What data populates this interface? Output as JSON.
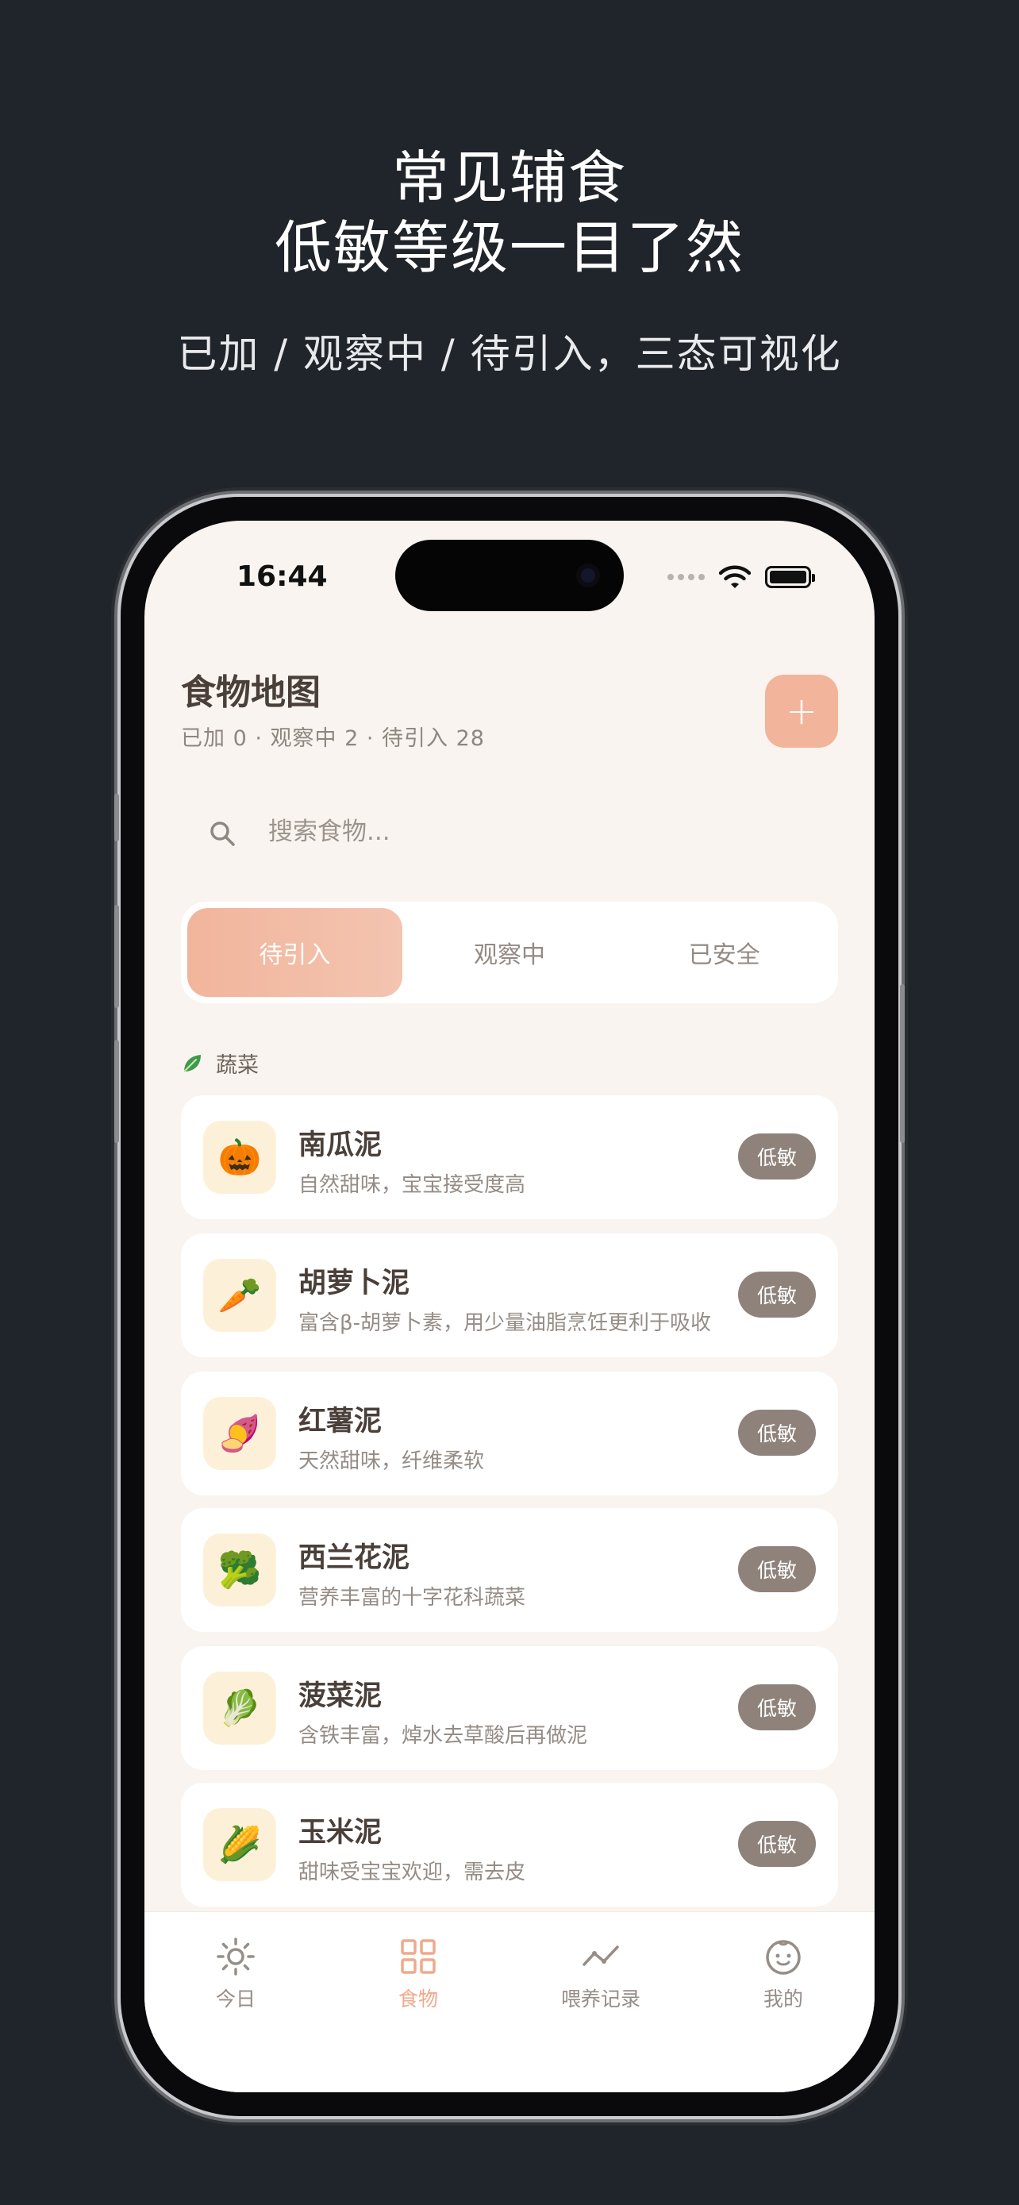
{
  "promo": {
    "title_line1": "常见辅食",
    "title_line2": "低敏等级一目了然",
    "subtitle": "已加 / 观察中 / 待引入，三态可视化"
  },
  "status_bar": {
    "time": "16:44"
  },
  "header": {
    "title": "食物地图",
    "summary": "已加 0 · 观察中 2 · 待引入 28",
    "add_label": "+"
  },
  "search": {
    "placeholder": "搜索食物..."
  },
  "segments": {
    "active": "待引入",
    "items": [
      "待引入",
      "观察中",
      "已安全"
    ]
  },
  "section": {
    "label": "蔬菜"
  },
  "foods": [
    {
      "emoji": "🎃",
      "name": "南瓜泥",
      "desc": "自然甜味，宝宝接受度高",
      "badge": "低敏"
    },
    {
      "emoji": "🥕",
      "name": "胡萝卜泥",
      "desc": "富含β-胡萝卜素，用少量油脂烹饪更利于吸收",
      "badge": "低敏"
    },
    {
      "emoji": "🍠",
      "name": "红薯泥",
      "desc": "天然甜味，纤维柔软",
      "badge": "低敏"
    },
    {
      "emoji": "🥦",
      "name": "西兰花泥",
      "desc": "营养丰富的十字花科蔬菜",
      "badge": "低敏"
    },
    {
      "emoji": "🥬",
      "name": "菠菜泥",
      "desc": "含铁丰富，焯水去草酸后再做泥",
      "badge": "低敏"
    },
    {
      "emoji": "🌽",
      "name": "玉米泥",
      "desc": "甜味受宝宝欢迎，需去皮",
      "badge": "低敏"
    }
  ],
  "tabbar": {
    "active": "食物",
    "items": [
      {
        "label": "今日",
        "icon": "sun-icon"
      },
      {
        "label": "食物",
        "icon": "grid-icon"
      },
      {
        "label": "喂养记录",
        "icon": "trend-icon"
      },
      {
        "label": "我的",
        "icon": "baby-face-icon"
      }
    ]
  },
  "colors": {
    "accent": "#f2b49a",
    "background": "#f9f4ef",
    "badge": "#8e827b",
    "promo_background": "#20242b"
  }
}
